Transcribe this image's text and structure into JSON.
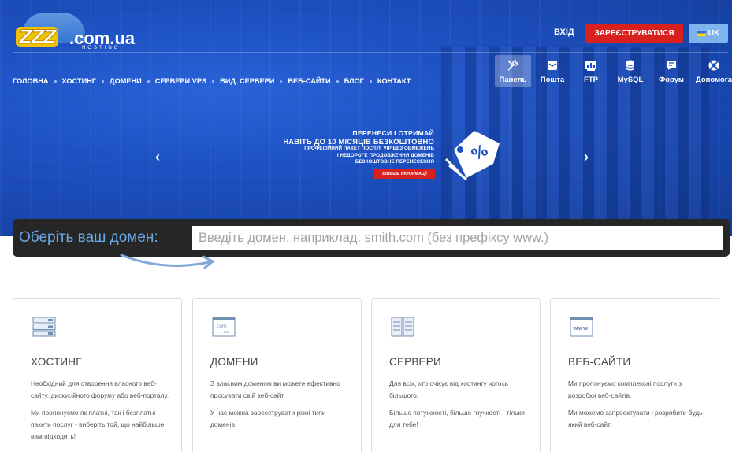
{
  "brand": {
    "logo_main": "ZZZ",
    "logo_domain": ".com.ua",
    "logo_sub": "HOSTING"
  },
  "header": {
    "login": "ВХІД",
    "register": "ЗАРЕЄСТРУВАТИСЯ",
    "language": "UK"
  },
  "nav": {
    "items": [
      "ГОЛОВНА",
      "ХОСТИНГ",
      "ДОМЕНИ",
      "СЕРВЕРИ VPS",
      "ВИД. СЕРВЕРИ",
      "ВЕБ-САЙТИ",
      "БЛОГ",
      "КОНТАКТ"
    ]
  },
  "tools": [
    {
      "label": "Панель",
      "icon": "tools-icon",
      "active": true
    },
    {
      "label": "Пошта",
      "icon": "mail-icon",
      "active": false
    },
    {
      "label": "FTP",
      "icon": "ftp-icon",
      "active": false
    },
    {
      "label": "MySQL",
      "icon": "database-icon",
      "active": false
    },
    {
      "label": "Форум",
      "icon": "chat-icon",
      "active": false
    },
    {
      "label": "Допомога",
      "icon": "lifebuoy-icon",
      "active": false
    }
  ],
  "banner": {
    "line1": "ПЕРЕНЕСИ І ОТРИМАЙ",
    "line2": "НАВІТЬ ДО 10 МІСЯЦІВ БЕЗКОШТОВНО",
    "line3": "ПРОФЕСІЙНИЙ ПАКЕТ ПОСЛУГ VIP БЕЗ ОБМЕЖЕНЬ",
    "line4": "І НЕДОРОГЕ ПРОДОВЖЕННЯ ДОМЕНІВ",
    "line5": "БЕЗКОШТОВНЕ ПЕРЕНЕСЕННЯ",
    "more": "БІЛЬШЕ ІНФОРМАЦІЇ",
    "prev": "‹",
    "next": "›"
  },
  "domain_search": {
    "label": "Оберіть ваш домен:",
    "placeholder": "Введіть домен, наприклад: smith.com (без префіксу www.)"
  },
  "cards": [
    {
      "title": "ХОСТИНГ",
      "icon": "server-rack-icon",
      "p1": "Необхідний для створення власного веб-сайту, дискусійного форуму або веб-порталу.",
      "p2": "Ми пропонуємо як платні, так і безплатні пакети послуг - виберіть той, що найбільше вам підходить!"
    },
    {
      "title": "ДОМЕНИ",
      "icon": "domain-window-icon",
      "icon_text1": ".com",
      "icon_text2": ".eu",
      "p1": "З власним доменом ви можете ефективно просувати свій веб-сайт.",
      "p2": "У нас можна зареєструвати різні типи доменів."
    },
    {
      "title": "СЕРВЕРИ",
      "icon": "servers-icon",
      "p1": "Для всіх, хто очікує від хостингу чогось більшого.",
      "p2": "Більше потужності, більше гнучкості - тільки для тебе!"
    },
    {
      "title": "ВЕБ-САЙТИ",
      "icon": "www-window-icon",
      "icon_text1": "www",
      "p1": "Ми пропонуємо комплексні послуги з розробки веб-сайтів.",
      "p2": "Ми можемо запроектувати і розробити будь-який веб-сайт."
    }
  ],
  "colors": {
    "hero_blue": "#1e52c4",
    "register_red": "#d8201e",
    "lang_blue": "#7fb3ee",
    "search_dark": "#262626",
    "search_label": "#6aa9e9"
  }
}
